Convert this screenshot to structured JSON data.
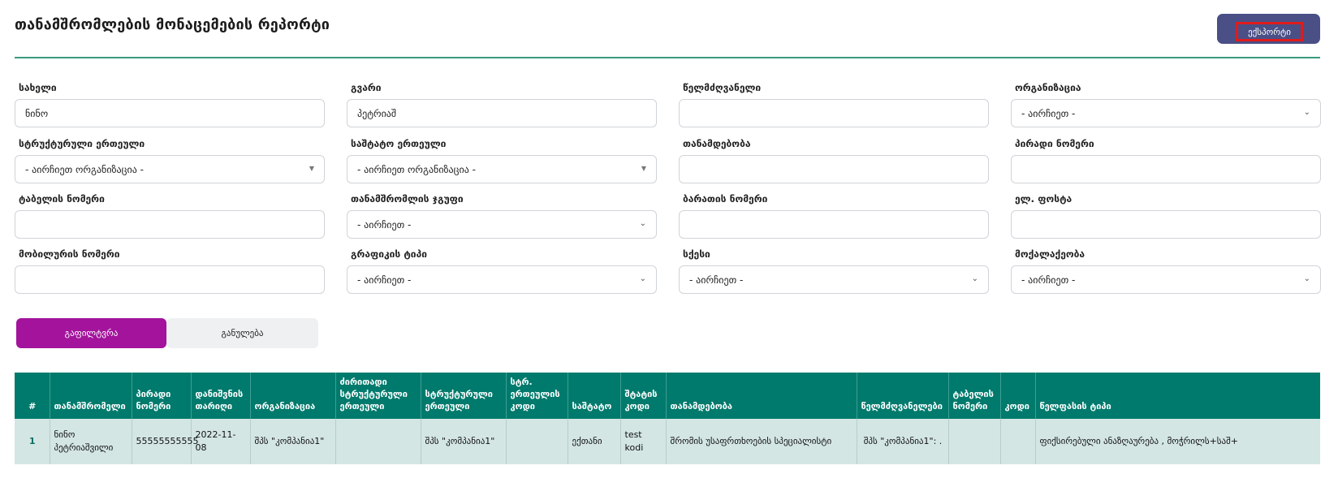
{
  "header": {
    "title": "თანამშრომლების მონაცემების რეპორტი",
    "export_label": "ექსპორტი"
  },
  "filters": [
    {
      "label": "სახელი",
      "value": "ნინო",
      "type": "input"
    },
    {
      "label": "გვარი",
      "value": "პეტრიაშ",
      "type": "input"
    },
    {
      "label": "წელმძღვანელი",
      "value": "",
      "type": "input"
    },
    {
      "label": "ორგანიზაცია",
      "value": "- აირჩიეთ -",
      "type": "select"
    },
    {
      "label": "სტრუქტურული ერთეული",
      "value": "- აირჩიეთ ორგანიზაცია -",
      "type": "select2"
    },
    {
      "label": "საშტატო ერთეული",
      "value": "- აირჩიეთ ორგანიზაცია -",
      "type": "select2"
    },
    {
      "label": "თანამდებობა",
      "value": "",
      "type": "input"
    },
    {
      "label": "პირადი ნომერი",
      "value": "",
      "type": "input"
    },
    {
      "label": "ტაბელის ნომერი",
      "value": "",
      "type": "input"
    },
    {
      "label": "თანამშრომლის ჯგუფი",
      "value": "- აირჩიეთ -",
      "type": "select"
    },
    {
      "label": "ბარათის ნომერი",
      "value": "",
      "type": "input"
    },
    {
      "label": "ელ. ფოსტა",
      "value": "",
      "type": "input"
    },
    {
      "label": "მობილურის ნომერი",
      "value": "",
      "type": "input"
    },
    {
      "label": "გრაფიკის ტიპი",
      "value": "- აირჩიეთ -",
      "type": "select"
    },
    {
      "label": "სქესი",
      "value": "- აირჩიეთ -",
      "type": "select"
    },
    {
      "label": "მოქალაქეობა",
      "value": "- აირჩიეთ -",
      "type": "select"
    }
  ],
  "actions": {
    "filter_label": "გაფილტვრა",
    "reset_label": "განულება"
  },
  "table": {
    "columns": [
      "#",
      "თანამშრომელი",
      "პირადი ნომერი",
      "დანიშვნის თარიღი",
      "ორგანიზაცია",
      "ძირითადი სტრუქტურული ერთეული",
      "სტრუქტურული ერთეული",
      "სტრ. ერთეულის კოდი",
      "საშტატო",
      "შტატის კოდი",
      "თანამდებობა",
      "წელმძღვანელები",
      "ტაბელის ნომერი",
      "კოდი",
      "წელფასის ტიპი"
    ],
    "rows": [
      [
        "1",
        "ნინო პეტრიაშვილი",
        "55555555555",
        "2022-11-08",
        "შპს \"კომპანია1\"",
        "",
        "შპს \"კომპანია1\"",
        "",
        "ექთანი",
        "test kodi",
        "შრომის უსაფრთხოების სპეციალისტი",
        "შპს \"კომპანია1\": .",
        "",
        "",
        "ფიქსირებული ანაზღაურება , მოჭრილს+საშ+"
      ]
    ]
  },
  "icons": {
    "select_caret": "chevron-down-icon",
    "select2_caret": "triangle-down-icon"
  },
  "colors": {
    "accent_green": "#007a6c",
    "filter_purple": "#a3139c",
    "export_navy": "#4a4f86",
    "highlight_red": "#e01b1b"
  }
}
